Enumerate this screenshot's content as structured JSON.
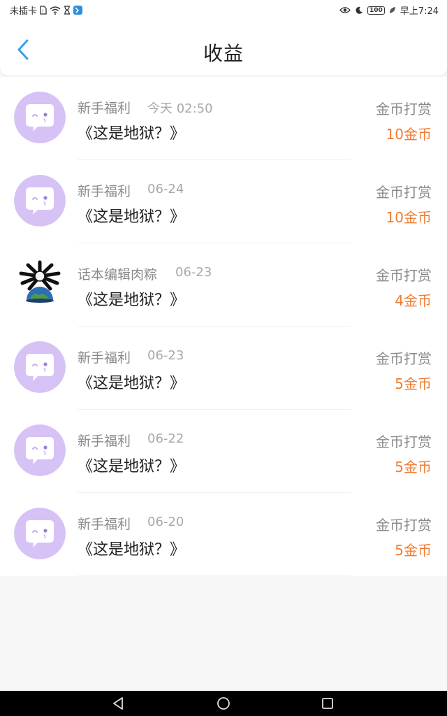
{
  "status_bar": {
    "carrier": "未插卡",
    "battery": "100",
    "time": "早上7:24"
  },
  "header": {
    "title": "收益"
  },
  "colors": {
    "accent": "#3aa0e8",
    "amount": "#f07a2f",
    "avatar_bg": "#d6c2f5"
  },
  "items": [
    {
      "sender": "新手福利",
      "date": "今天 02:50",
      "book": "《这是地狱？》",
      "type": "金币打赏",
      "amount": "10金币",
      "avatar": "bot-avatar-icon"
    },
    {
      "sender": "新手福利",
      "date": "06-24",
      "book": "《这是地狱？》",
      "type": "金币打赏",
      "amount": "10金币",
      "avatar": "bot-avatar-icon"
    },
    {
      "sender": "话本编辑肉粽",
      "date": "06-23",
      "book": "《这是地狱？》",
      "type": "金币打赏",
      "amount": "4金币",
      "avatar": "earth-avatar-icon"
    },
    {
      "sender": "新手福利",
      "date": "06-23",
      "book": "《这是地狱？》",
      "type": "金币打赏",
      "amount": "5金币",
      "avatar": "bot-avatar-icon"
    },
    {
      "sender": "新手福利",
      "date": "06-22",
      "book": "《这是地狱？》",
      "type": "金币打赏",
      "amount": "5金币",
      "avatar": "bot-avatar-icon"
    },
    {
      "sender": "新手福利",
      "date": "06-20",
      "book": "《这是地狱？》",
      "type": "金币打赏",
      "amount": "5金币",
      "avatar": "bot-avatar-icon"
    }
  ]
}
